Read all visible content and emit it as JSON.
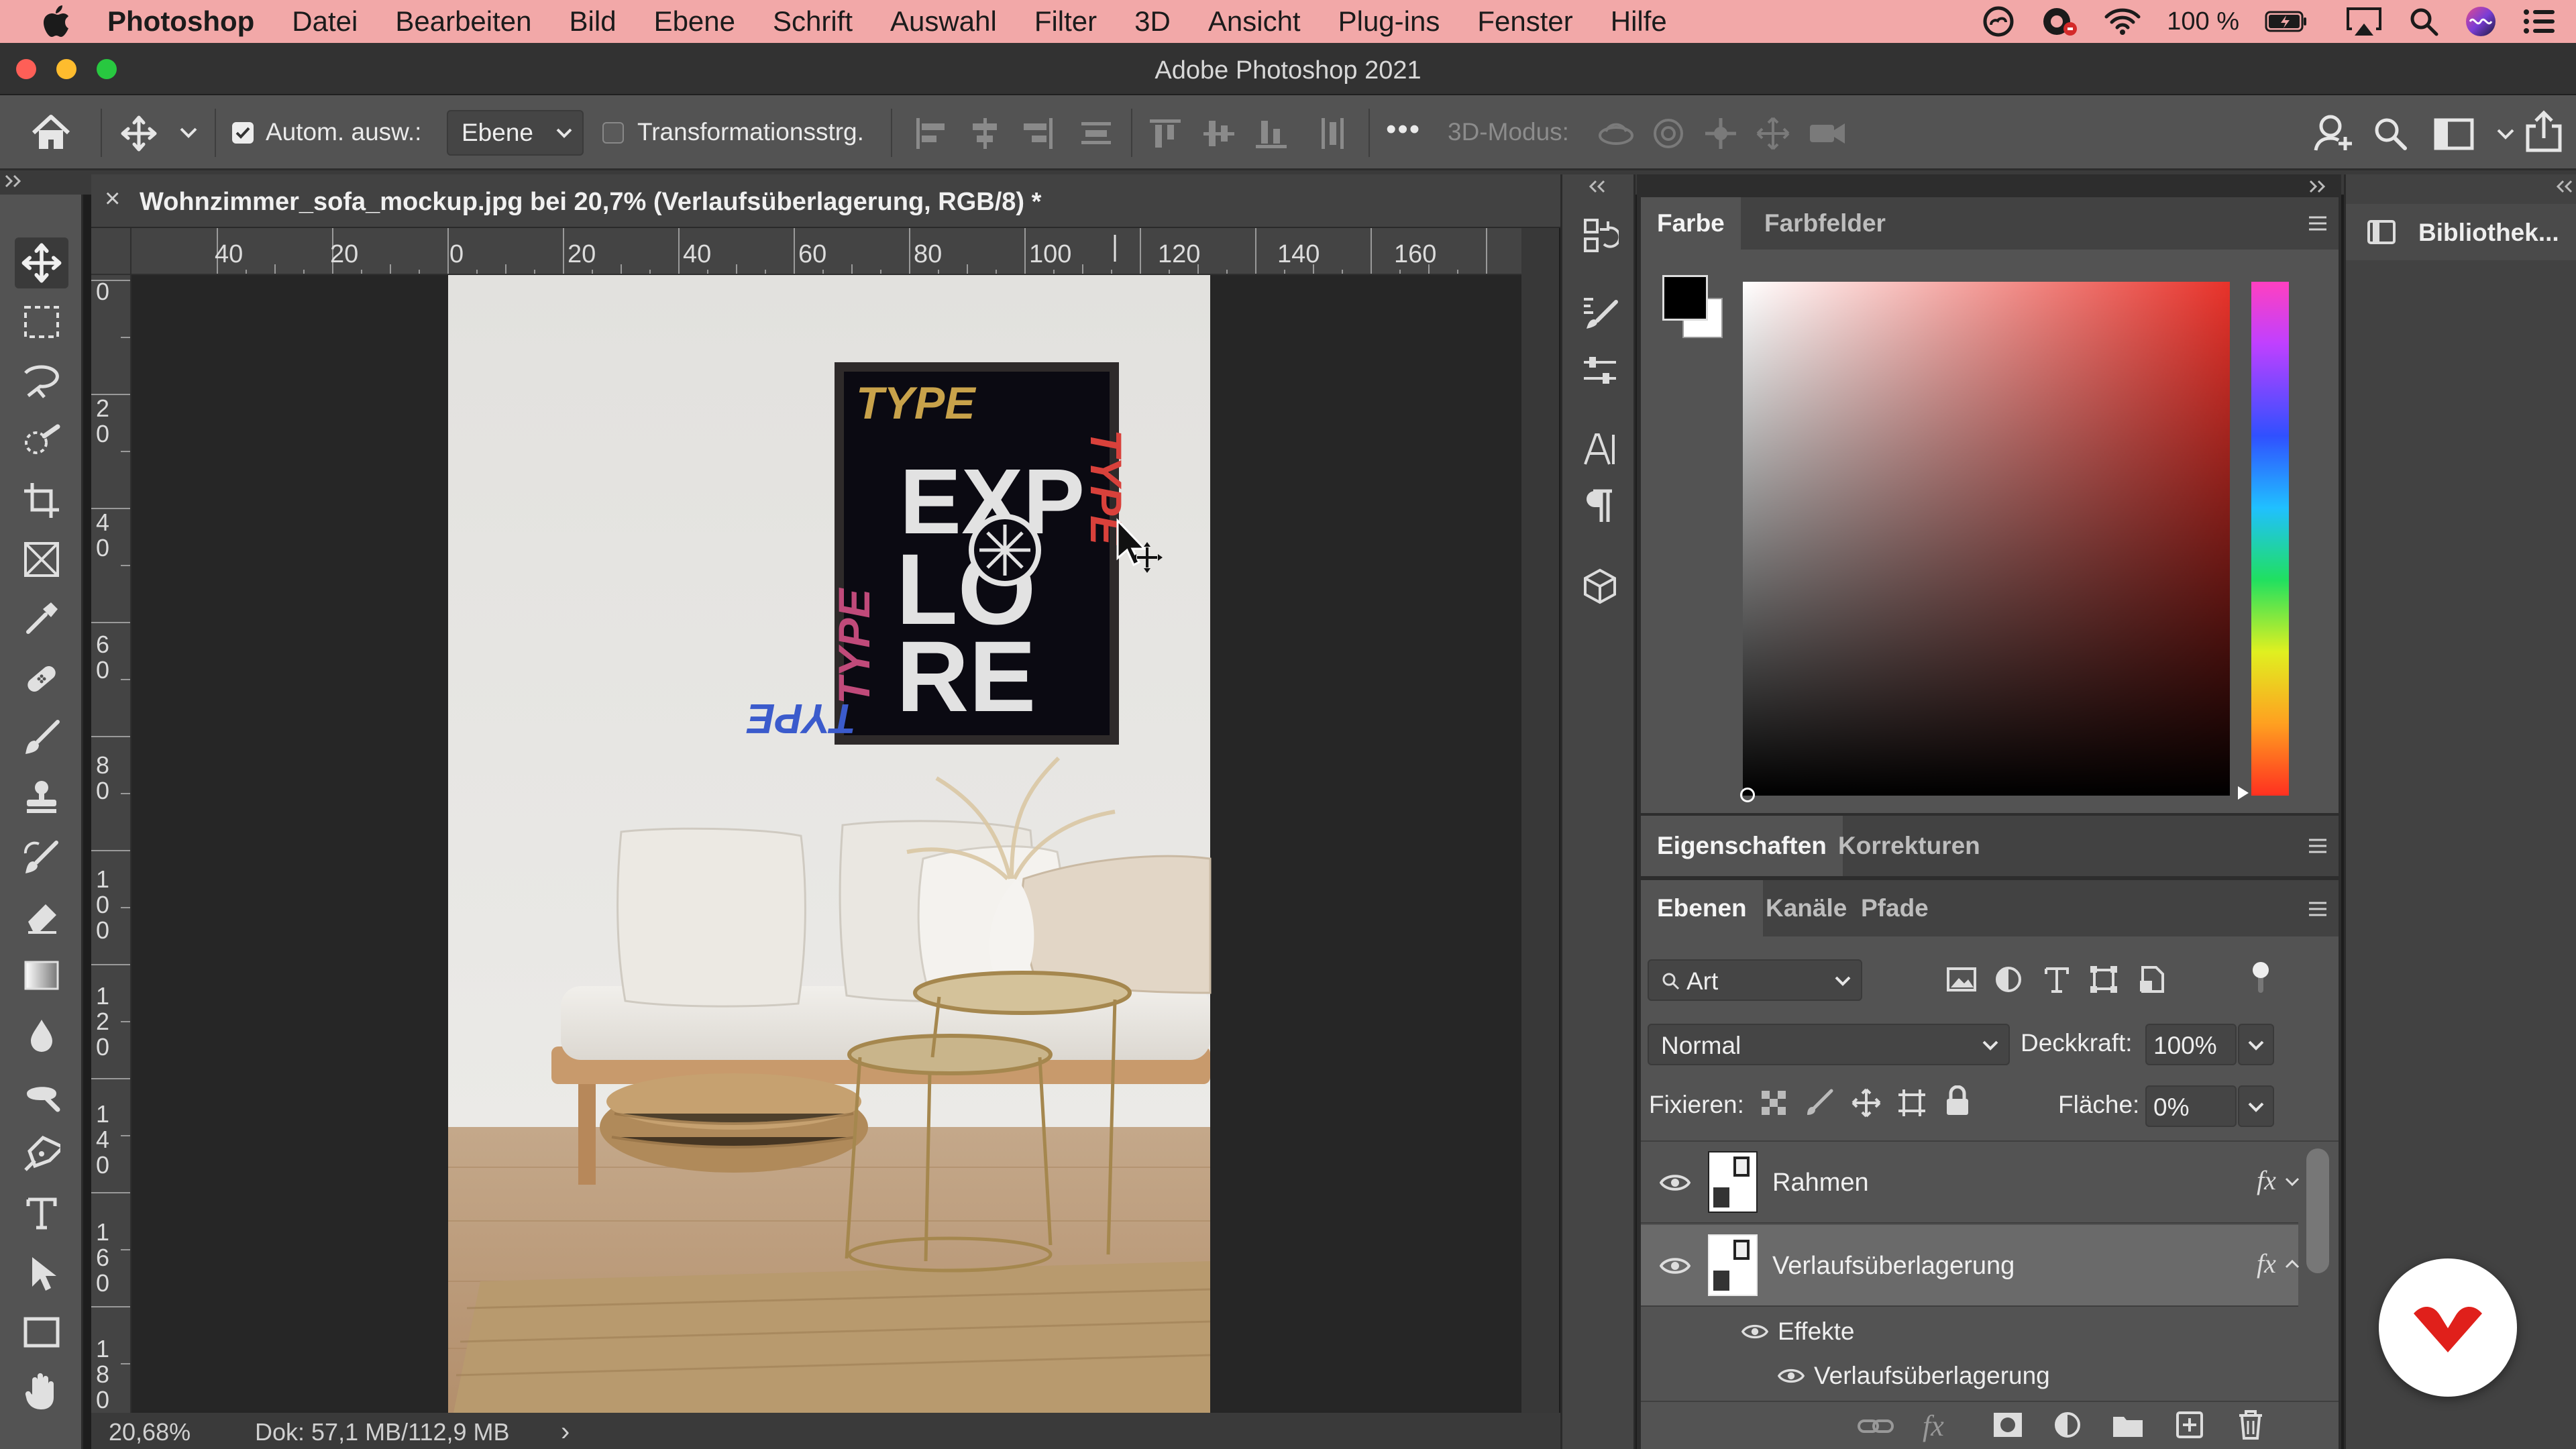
{
  "menubar": {
    "items": [
      "Photoshop",
      "Datei",
      "Bearbeiten",
      "Bild",
      "Ebene",
      "Schrift",
      "Auswahl",
      "Filter",
      "3D",
      "Ansicht",
      "Plug-ins",
      "Fenster",
      "Hilfe"
    ],
    "battery": "100 %"
  },
  "window": {
    "title": "Adobe Photoshop 2021"
  },
  "options": {
    "auto_select_label": "Autom. ausw.:",
    "auto_select_target": "Ebene",
    "transform_label": "Transformationsstrg.",
    "mode3d_label": "3D-Modus:",
    "more": "•••"
  },
  "document": {
    "tab_title": "Wohnzimmer_sofa_mockup.jpg bei 20,7% (Verlaufsüberlagerung, RGB/8) *",
    "close": "×",
    "ruler_h": [
      "40",
      "20",
      "0",
      "20",
      "40",
      "60",
      "80",
      "100",
      "120",
      "140",
      "160"
    ],
    "ruler_v": [
      "0",
      "2 0",
      "4 0",
      "6 0",
      "8 0",
      "1 0 0",
      "1 2 0",
      "1 4 0",
      "1 6 0",
      "1 8 0"
    ],
    "status": {
      "zoom": "20,68%",
      "doc": "Dok: 57,1 MB/112,9 MB",
      "arrow": "›"
    },
    "poster": {
      "top": "TYPE",
      "lines": [
        "EXP",
        "LO",
        "RE"
      ],
      "side": "TYPE",
      "bottom": "TYPE"
    }
  },
  "color_panel": {
    "tabs": [
      "Farbe",
      "Farbfelder"
    ],
    "foreground": "#000000",
    "background": "#ffffff",
    "hue_color": "#e8322a"
  },
  "props_panel": {
    "tabs": [
      "Eigenschaften",
      "Korrekturen"
    ]
  },
  "layers_panel": {
    "tabs": [
      "Ebenen",
      "Kanäle",
      "Pfade"
    ],
    "filter_label": "Art",
    "blend_mode": "Normal",
    "opacity_label": "Deckkraft:",
    "opacity_value": "100%",
    "lock_label": "Fixieren:",
    "fill_label": "Fläche:",
    "fill_value": "0%",
    "layers": [
      {
        "name": "Rahmen",
        "fx": "fx"
      },
      {
        "name": "Verlaufsüberlagerung",
        "fx": "fx"
      }
    ],
    "effects_label": "Effekte",
    "effect_item": "Verlaufsüberlagerung"
  },
  "right_dock": {
    "libraries_label": "Bibliothek..."
  },
  "colors": {
    "menubar": "#f2a8a8",
    "panel": "#535353",
    "accent_red": "#e0201b"
  }
}
